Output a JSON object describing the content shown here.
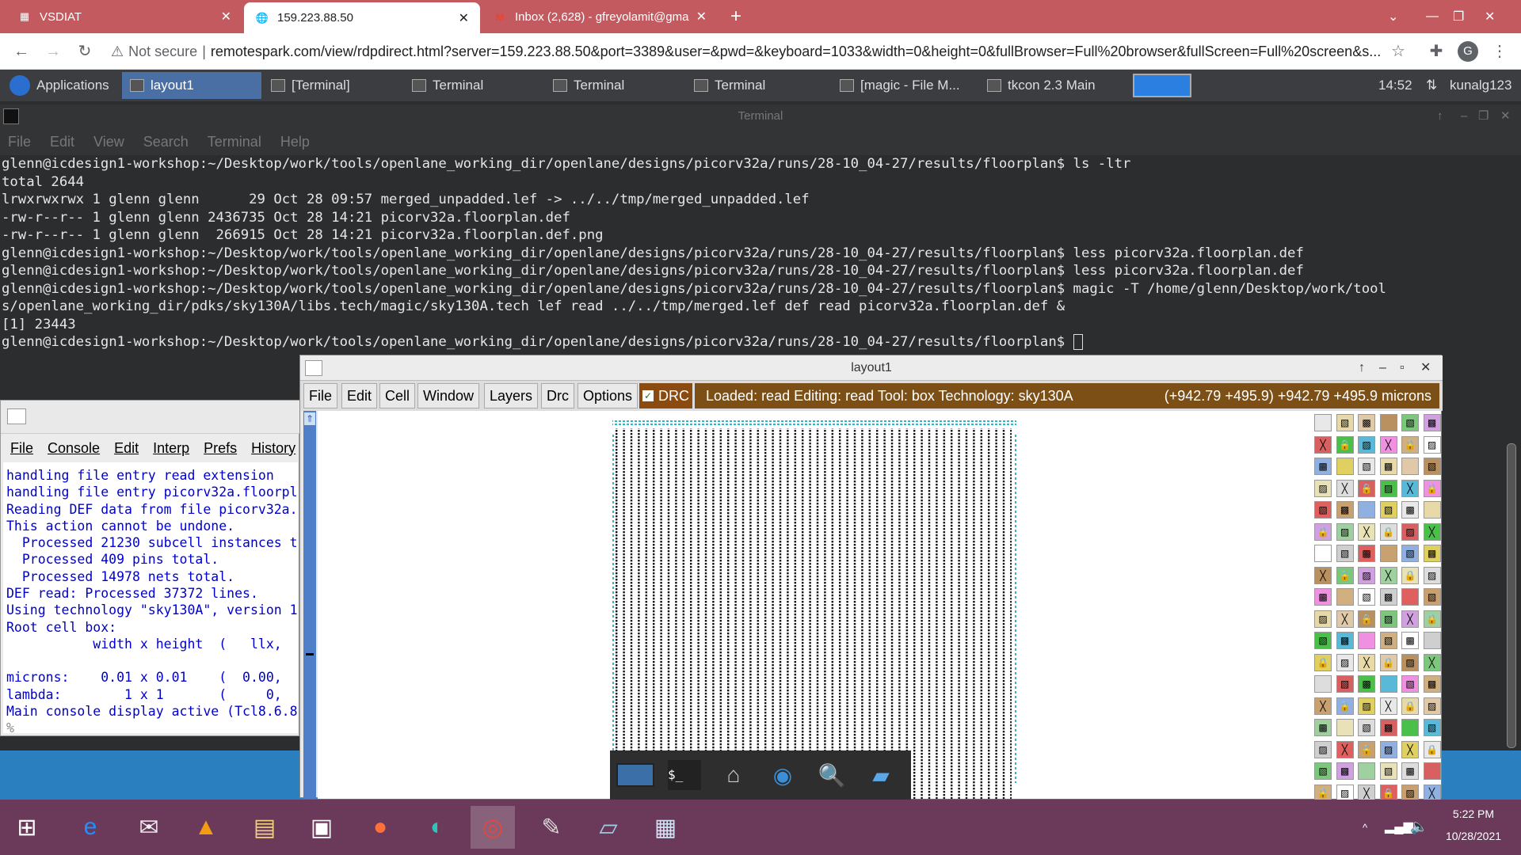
{
  "browser": {
    "tabs": [
      {
        "title": "VSDIAT"
      },
      {
        "title": "159.223.88.50"
      },
      {
        "title": "Inbox (2,628) - gfreyolamit@gma"
      }
    ],
    "new_tab": "+",
    "security": "Not secure",
    "url": "remotespark.com/view/rdpdirect.html?server=159.223.88.50&port=3389&user=&pwd=&keyboard=1033&width=0&height=0&fullBrowser=Full%20browser&fullScreen=Full%20screen&s...",
    "profile_initial": "G"
  },
  "panel": {
    "applications": "Applications",
    "tasks": [
      "layout1",
      "[Terminal]",
      "Terminal",
      "Terminal",
      "Terminal",
      "[magic - File M...",
      "tkcon 2.3 Main"
    ],
    "time": "14:52",
    "user": "kunalg123"
  },
  "terminal": {
    "title": "Terminal",
    "menu": [
      "File",
      "Edit",
      "View",
      "Search",
      "Terminal",
      "Help"
    ],
    "lines": [
      "glenn@icdesign1-workshop:~/Desktop/work/tools/openlane_working_dir/openlane/designs/picorv32a/runs/28-10_04-27/results/floorplan$ ls -ltr",
      "total 2644",
      "lrwxrwxrwx 1 glenn glenn      29 Oct 28 09:57 merged_unpadded.lef -> ../../tmp/merged_unpadded.lef",
      "-rw-r--r-- 1 glenn glenn 2436735 Oct 28 14:21 picorv32a.floorplan.def",
      "-rw-r--r-- 1 glenn glenn  266915 Oct 28 14:21 picorv32a.floorplan.def.png",
      "glenn@icdesign1-workshop:~/Desktop/work/tools/openlane_working_dir/openlane/designs/picorv32a/runs/28-10_04-27/results/floorplan$ less picorv32a.floorplan.def",
      "glenn@icdesign1-workshop:~/Desktop/work/tools/openlane_working_dir/openlane/designs/picorv32a/runs/28-10_04-27/results/floorplan$ less picorv32a.floorplan.def",
      "glenn@icdesign1-workshop:~/Desktop/work/tools/openlane_working_dir/openlane/designs/picorv32a/runs/28-10_04-27/results/floorplan$ magic -T /home/glenn/Desktop/work/tool",
      "s/openlane_working_dir/pdks/sky130A/libs.tech/magic/sky130A.tech lef read ../../tmp/merged.lef def read picorv32a.floorplan.def &",
      "[1] 23443",
      "glenn@icdesign1-workshop:~/Desktop/work/tools/openlane_working_dir/openlane/designs/picorv32a/runs/28-10_04-27/results/floorplan$ "
    ]
  },
  "tkcon": {
    "menu": [
      "File",
      "Console",
      "Edit",
      "Interp",
      "Prefs",
      "History"
    ],
    "lines": [
      "handling file entry read extension",
      "handling file entry picorv32a.floorpl",
      "Reading DEF data from file picorv32a.",
      "This action cannot be undone.",
      "  Processed 21230 subcell instances t",
      "  Processed 409 pins total.",
      "  Processed 14978 nets total.",
      "DEF read: Processed 37372 lines.",
      "Using technology \"sky130A\", version 1",
      "Root cell box:",
      "           width x height  (   llx,",
      "",
      "microns:    0.01 x 0.01    (  0.00,",
      "lambda:        1 x 1       (     0,",
      "Main console display active (Tcl8.6.8",
      "%"
    ]
  },
  "magic": {
    "title": "layout1",
    "menu": [
      "File",
      "Edit",
      "Cell",
      "Window",
      "Layers",
      "Drc",
      "Options"
    ],
    "drc_label": "DRC",
    "status": "Loaded: read Editing: read Tool: box  Technology: sky130A",
    "coords": "(+942.79 +495.9) +942.79 +495.9 microns"
  },
  "clock": {
    "time": "5:22 PM",
    "date": "10/28/2021"
  }
}
